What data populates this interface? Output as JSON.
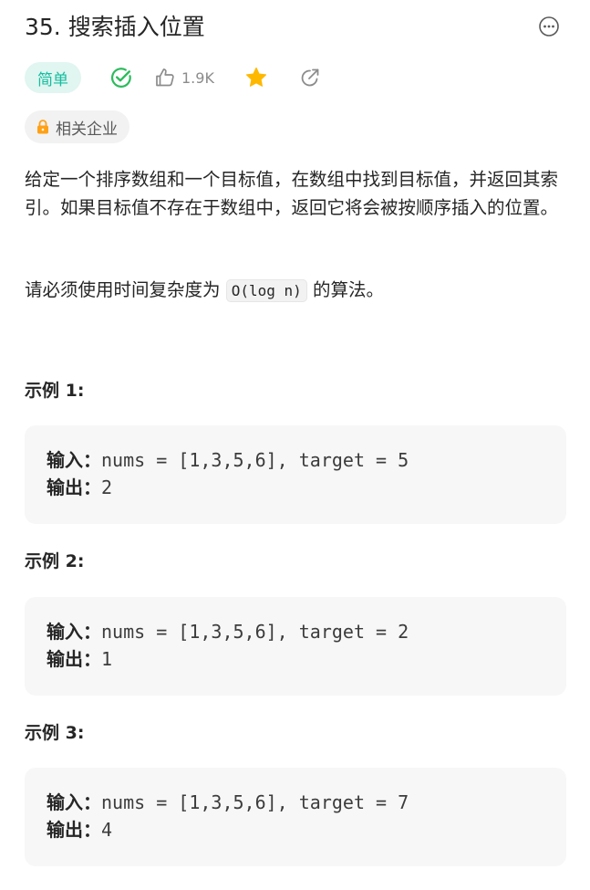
{
  "problem": {
    "title": "35. 搜索插入位置",
    "difficulty": "简单",
    "likes": "1.9K",
    "company_tag": "相关企业",
    "description_1": "给定一个排序数组和一个目标值，在数组中找到目标值，并返回其索引。如果目标值不存在于数组中，返回它将会被按顺序插入的位置。",
    "description_2_before": "请必须使用时间复杂度为 ",
    "description_2_code": "O(log n)",
    "description_2_after": " 的算法。"
  },
  "examples": [
    {
      "title": "示例 1:",
      "input_label": "输入：",
      "input_value": "nums = [1,3,5,6], target = 5",
      "output_label": "输出：",
      "output_value": "2"
    },
    {
      "title": "示例 2:",
      "input_label": "输入：",
      "input_value": "nums = [1,3,5,6], target = 2",
      "output_label": "输出：",
      "output_value": "1"
    },
    {
      "title": "示例 3:",
      "input_label": "输入：",
      "input_value": "nums = [1,3,5,6], target = 7",
      "output_label": "输出：",
      "output_value": "4"
    }
  ],
  "icons": {
    "more": "more-icon",
    "solved": "check-circle-icon",
    "like": "thumbs-up-icon",
    "star": "star-icon",
    "share": "share-icon",
    "lock": "lock-icon"
  },
  "colors": {
    "difficulty_text": "#15bd9f",
    "difficulty_bg": "#e1f5f1",
    "solved": "#2cbb5d",
    "star": "#ffb800",
    "lock": "#ffa116"
  }
}
